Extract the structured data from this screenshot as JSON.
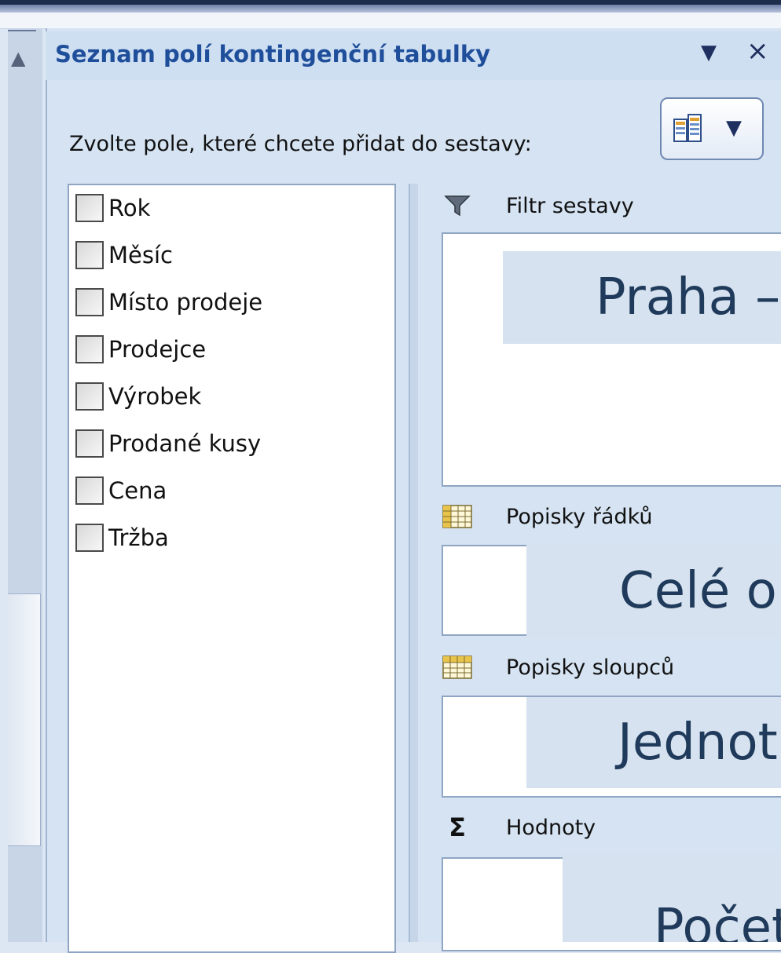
{
  "pane": {
    "title": "Seznam polí kontingenční tabulky",
    "menu_glyph": "▼",
    "close_glyph": "×",
    "instruction": "Zvolte pole, které chcete přidat do sestavy:",
    "layout_button_arrow": "▼"
  },
  "fields": [
    {
      "label": "Rok",
      "checked": false
    },
    {
      "label": "Měsíc",
      "checked": false
    },
    {
      "label": "Místo prodeje",
      "checked": false
    },
    {
      "label": "Prodejce",
      "checked": false
    },
    {
      "label": "Výrobek",
      "checked": false
    },
    {
      "label": "Prodané kusy",
      "checked": false
    },
    {
      "label": "Cena",
      "checked": false
    },
    {
      "label": "Tržba",
      "checked": false
    }
  ],
  "areas": {
    "filter": {
      "label": "Filtr sestavy",
      "icon": "filter-icon"
    },
    "rows": {
      "label": "Popisky řádků",
      "icon": "grid-icon"
    },
    "columns": {
      "label": "Popisky sloupců",
      "icon": "grid-icon"
    },
    "values": {
      "label": "Hodnoty",
      "icon": "sigma-icon",
      "glyph": "Σ"
    }
  },
  "overlays": {
    "filter": "Praha –",
    "rows": "Celé o",
    "columns": "Jednot",
    "values": "Počet"
  },
  "colors": {
    "title": "#1f4e9b",
    "pane_bg": "#d5e3f2",
    "border": "#8fa5c3",
    "overlay_bg": "#d6e2ef",
    "overlay_text": "#1f3a5a"
  }
}
